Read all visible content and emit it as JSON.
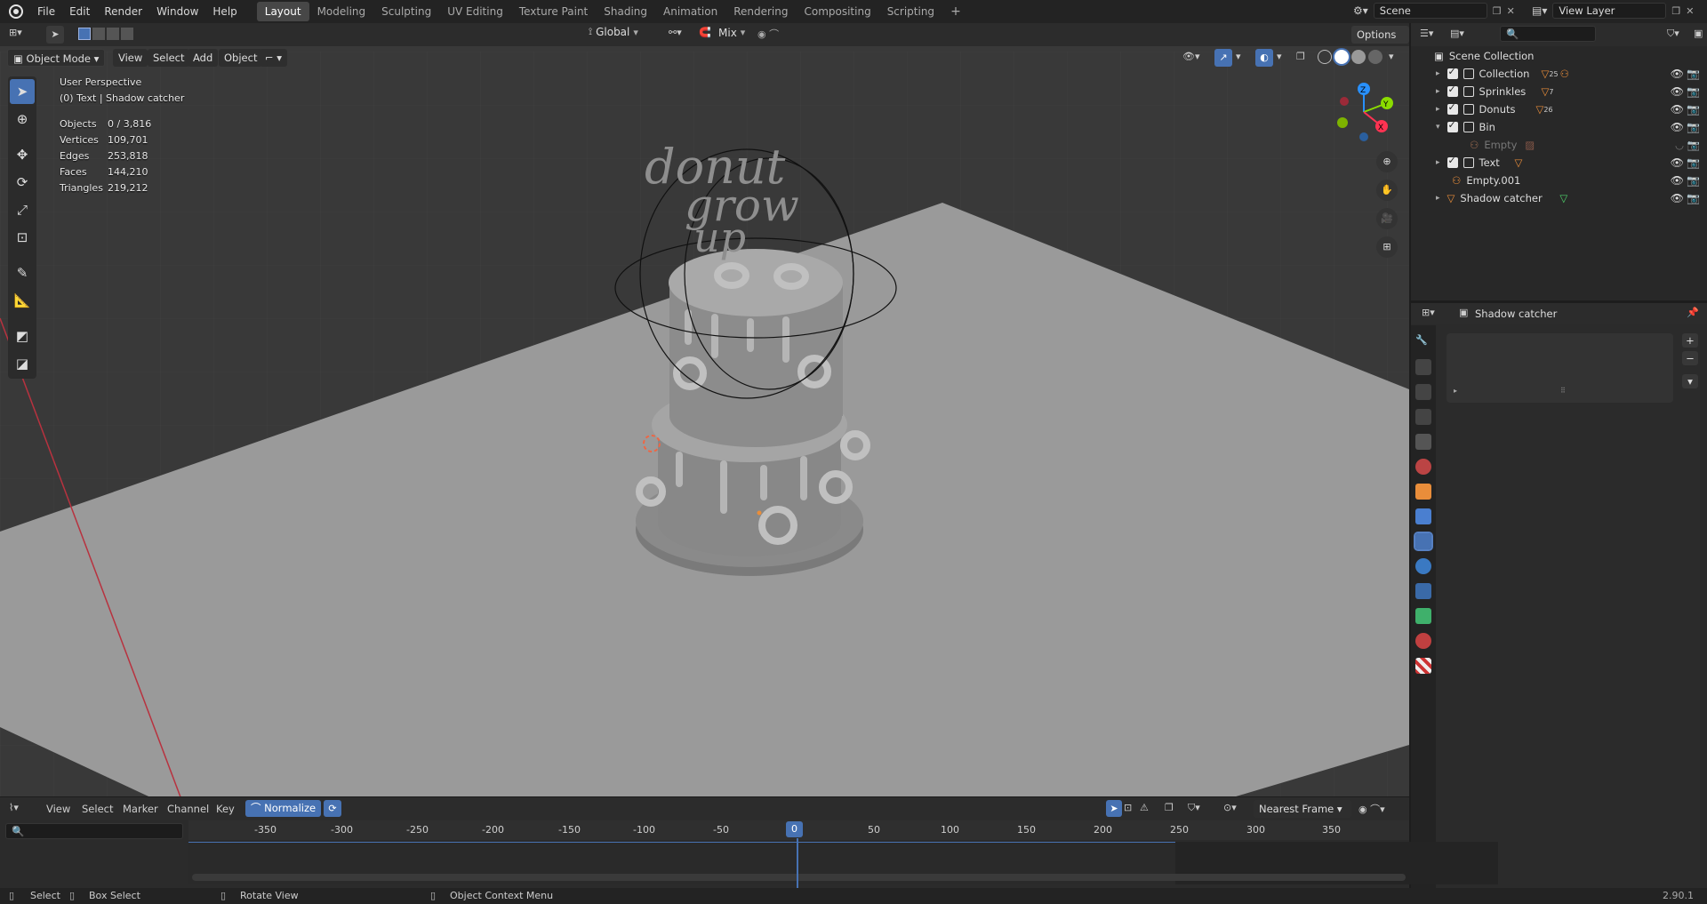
{
  "menu": [
    "File",
    "Edit",
    "Render",
    "Window",
    "Help"
  ],
  "workspaces": [
    "Layout",
    "Modeling",
    "Sculpting",
    "UV Editing",
    "Texture Paint",
    "Shading",
    "Animation",
    "Rendering",
    "Compositing",
    "Scripting"
  ],
  "active_workspace": "Layout",
  "scene": {
    "name": "Scene",
    "view_layer": "View Layer"
  },
  "viewport_header": {
    "mode": "Object Mode",
    "menus": [
      "View",
      "Select",
      "Add",
      "Object"
    ],
    "orientation": "Global",
    "snap_mode": "Mix",
    "options": "Options"
  },
  "overlay": {
    "perspective": "User Perspective",
    "context": "(0) Text | Shadow catcher",
    "stats": [
      {
        "label": "Objects",
        "value": "0 / 3,816"
      },
      {
        "label": "Vertices",
        "value": "109,701"
      },
      {
        "label": "Edges",
        "value": "253,818"
      },
      {
        "label": "Faces",
        "value": "144,210"
      },
      {
        "label": "Triangles",
        "value": "219,212"
      }
    ]
  },
  "gizmo_axes": [
    "Z",
    "Y",
    "X"
  ],
  "cake_text": [
    "donut",
    "grow",
    "up"
  ],
  "outliner": {
    "root": "Scene Collection",
    "items": [
      {
        "label": "Collection",
        "badge": "25"
      },
      {
        "label": "Sprinkles",
        "badge": "7"
      },
      {
        "label": "Donuts",
        "badge": "26"
      },
      {
        "label": "Bin",
        "badge": ""
      },
      {
        "label": "Empty",
        "badge": ""
      },
      {
        "label": "Text",
        "badge": ""
      },
      {
        "label": "Empty.001",
        "badge": ""
      },
      {
        "label": "Shadow catcher",
        "badge": ""
      }
    ]
  },
  "properties": {
    "object_name": "Shadow catcher"
  },
  "timeline": {
    "menus": [
      "View",
      "Select",
      "Marker",
      "Channel",
      "Key"
    ],
    "normalize": "Normalize",
    "interpolation": "Nearest Frame",
    "ticks": [
      "-350",
      "-300",
      "-250",
      "-200",
      "-150",
      "-100",
      "-50",
      "0",
      "50",
      "100",
      "150",
      "200",
      "250",
      "300",
      "350"
    ],
    "current_frame": "0"
  },
  "statusbar": {
    "select": "Select",
    "box_select": "Box Select",
    "rotate": "Rotate View",
    "context_menu": "Object Context Menu",
    "version": "2.90.1"
  },
  "colors": {
    "accent": "#4772b3",
    "x_axis": "#ff3352",
    "y_axis": "#8bdc00",
    "z_axis": "#2890ff",
    "orange": "#e98d3a"
  }
}
